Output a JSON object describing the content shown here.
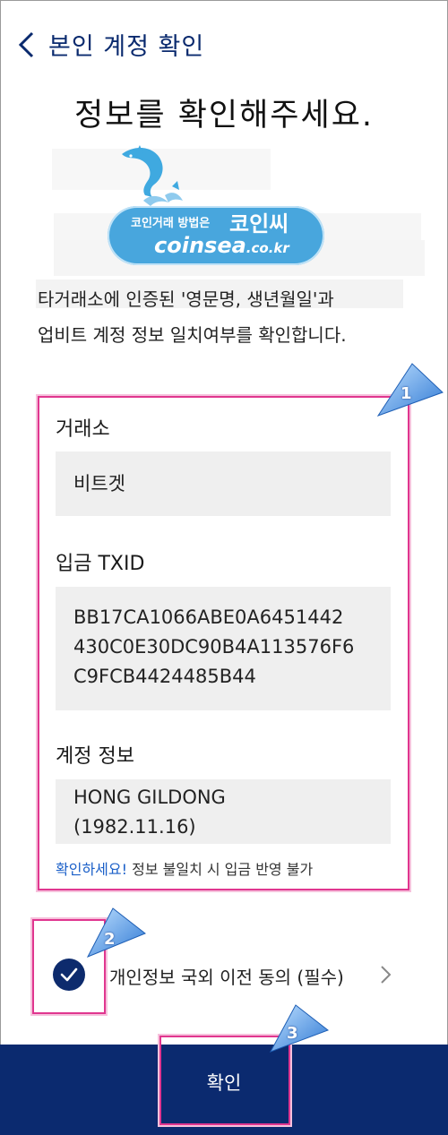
{
  "header": {
    "title": "본인 계정 확인",
    "back_icon": "chevron-left-icon"
  },
  "main_title": "정보를 확인해주세요.",
  "watermark": {
    "line1_small": "코인거래 방법은",
    "line1_big": "코인씨",
    "line2_main": "coinsea",
    "line2_suffix": ".co.kr"
  },
  "description": {
    "line1": "타거래소에 인증된 '영문명, 생년월일'과",
    "line2": "업비트 계정 정보 일치여부를 확인합니다."
  },
  "fields": {
    "exchange": {
      "label": "거래소",
      "value": "비트겟"
    },
    "txid": {
      "label": "입금 TXID",
      "lines": [
        "BB17CA1066ABE0A6451442",
        "430C0E30DC90B4A113576F6",
        "C9FCB4424485B44"
      ]
    },
    "account": {
      "label": "계정 정보",
      "lines": [
        "HONG GILDONG",
        "(1982.11.16)"
      ]
    }
  },
  "warning": {
    "accent": "확인하세요!",
    "text": " 정보 불일치 시 입금 반영 불가"
  },
  "agreement": {
    "label": "개인정보 국외 이전 동의 (필수)",
    "checked": true
  },
  "confirm_button": {
    "label": "확인"
  },
  "callouts": [
    "1",
    "2",
    "3"
  ],
  "colors": {
    "accent_navy": "#0b2a6f",
    "highlight_pink": "#e0368f",
    "link_blue": "#1a5fc8"
  }
}
